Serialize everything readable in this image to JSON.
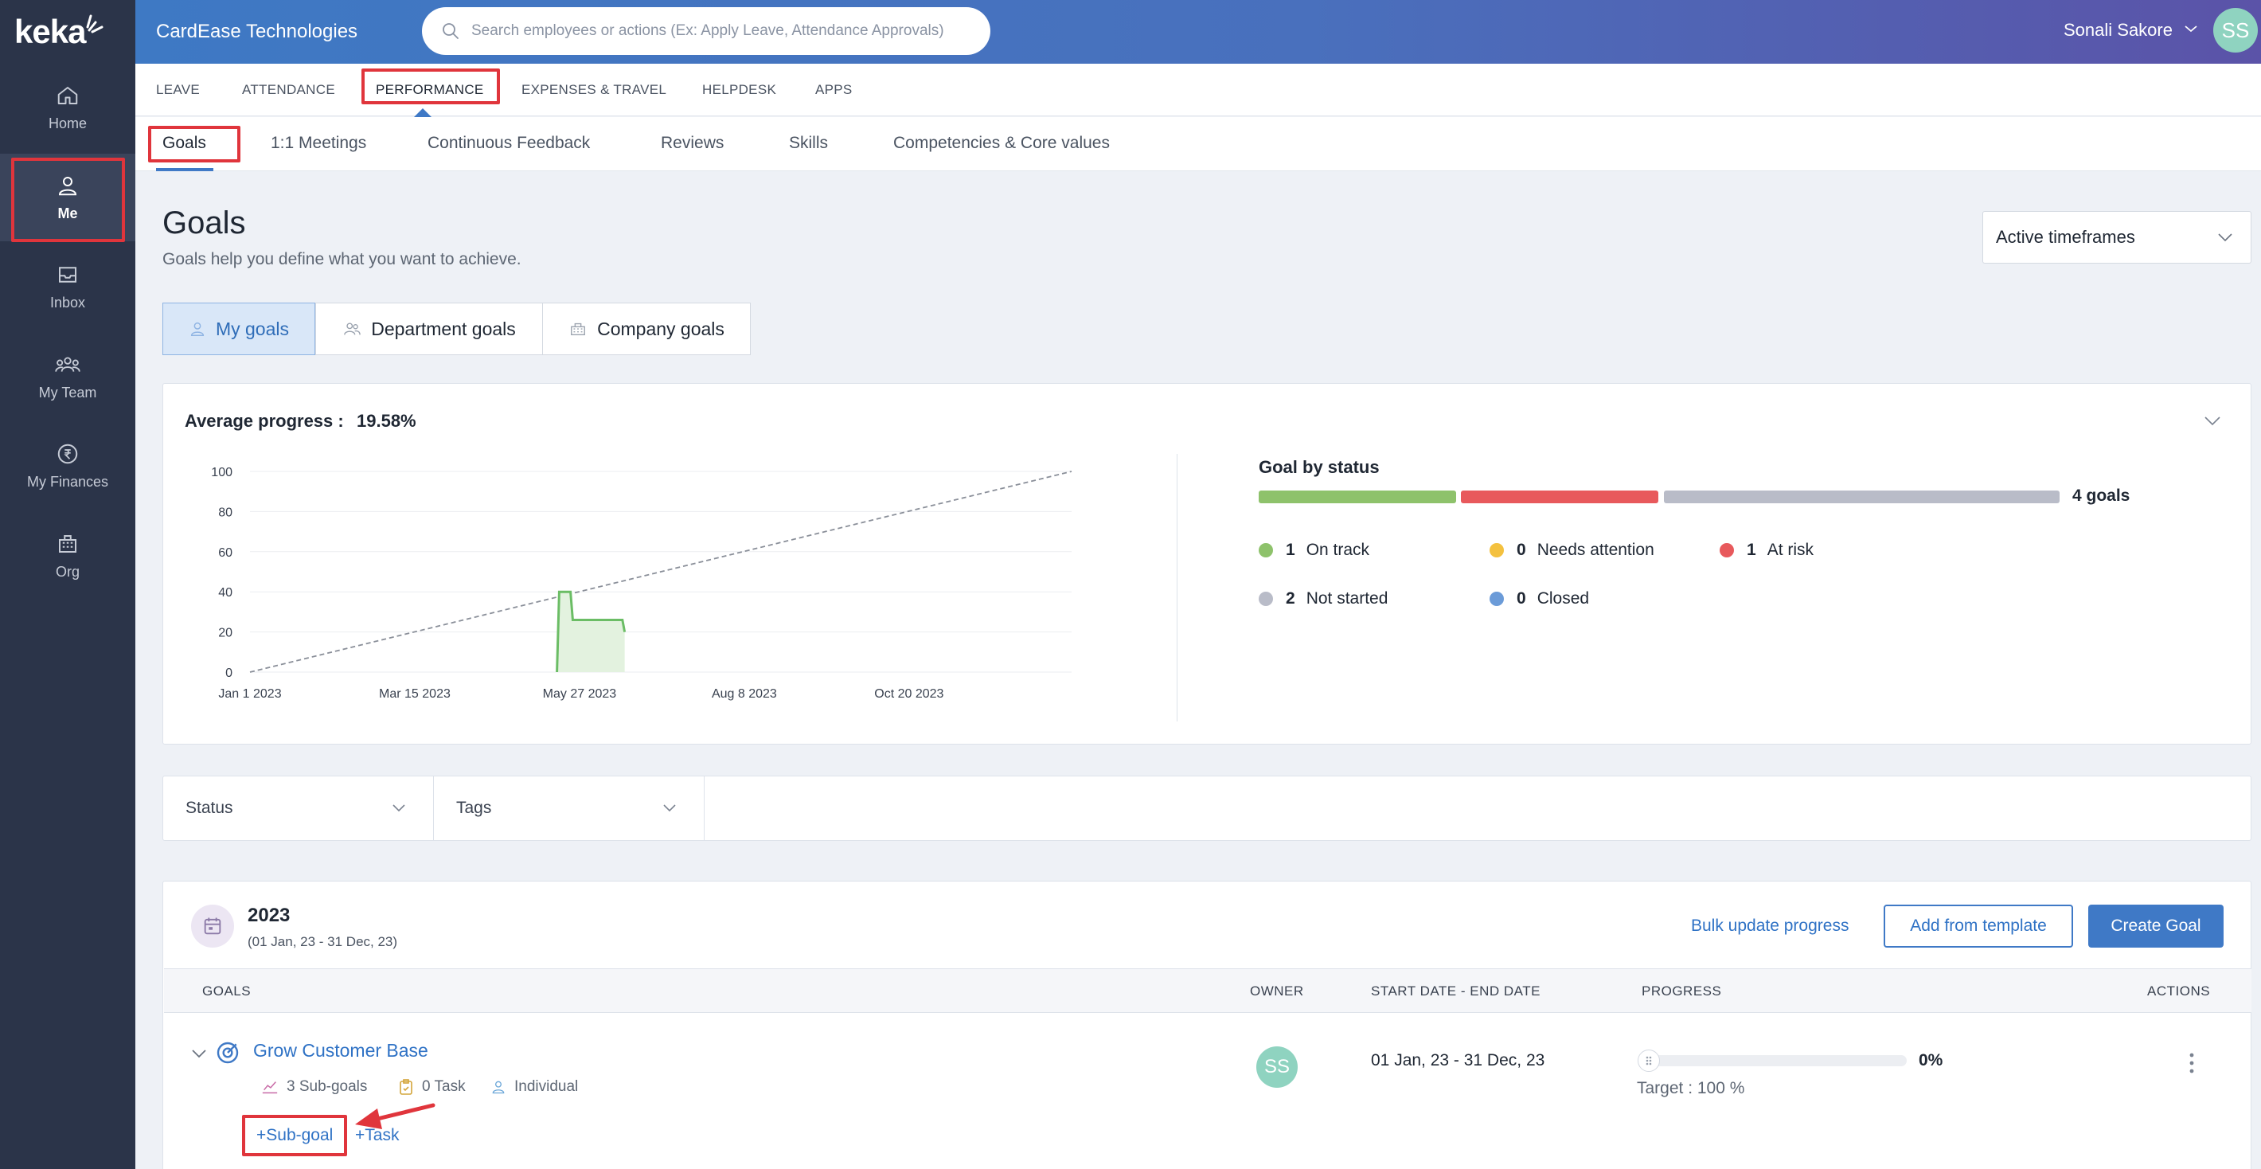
{
  "app": {
    "logo_text": "keka",
    "company_name": "CardEase Technologies",
    "user_name": "Sonali Sakore",
    "user_initials": "SS"
  },
  "search": {
    "placeholder": "Search employees or actions (Ex: Apply Leave, Attendance Approvals)"
  },
  "sidebar": {
    "items": [
      {
        "label": "Home",
        "icon": "home-icon"
      },
      {
        "label": "Me",
        "icon": "user-icon",
        "active": true
      },
      {
        "label": "Inbox",
        "icon": "inbox-icon"
      },
      {
        "label": "My Team",
        "icon": "team-icon"
      },
      {
        "label": "My Finances",
        "icon": "rupee-icon"
      },
      {
        "label": "Org",
        "icon": "org-icon"
      }
    ]
  },
  "module_tabs": [
    {
      "label": "LEAVE"
    },
    {
      "label": "ATTENDANCE"
    },
    {
      "label": "PERFORMANCE",
      "active": true
    },
    {
      "label": "EXPENSES & TRAVEL"
    },
    {
      "label": "HELPDESK"
    },
    {
      "label": "APPS"
    }
  ],
  "sub_tabs": [
    {
      "label": "Goals",
      "active": true
    },
    {
      "label": "1:1 Meetings"
    },
    {
      "label": "Continuous Feedback"
    },
    {
      "label": "Reviews"
    },
    {
      "label": "Skills"
    },
    {
      "label": "Competencies & Core values"
    }
  ],
  "page": {
    "title": "Goals",
    "subtitle": "Goals help you define what you want to achieve.",
    "timeframe_selected": "Active timeframes"
  },
  "goal_tabs": [
    {
      "label": "My goals",
      "active": true,
      "icon": "person-icon"
    },
    {
      "label": "Department goals",
      "icon": "group-icon"
    },
    {
      "label": "Company goals",
      "icon": "building-icon"
    }
  ],
  "progress_card": {
    "avg_label": "Average progress :",
    "avg_value": "19.58%"
  },
  "chart_data": {
    "type": "line",
    "title": "",
    "xlabel": "",
    "ylabel": "",
    "ylim": [
      0,
      100
    ],
    "y_ticks": [
      "100",
      "80",
      "60",
      "40",
      "20",
      "0"
    ],
    "x_ticks": [
      "Jan 1 2023",
      "Mar 15 2023",
      "May 27 2023",
      "Aug 8 2023",
      "Oct 20 2023"
    ],
    "x_range": [
      "2023-01-01",
      "2023-12-31"
    ],
    "grid": true,
    "series": [
      {
        "style": "dashed",
        "color": "#8a8f99",
        "x": [
          "2023-01-01",
          "2023-12-31"
        ],
        "y": [
          0,
          100
        ]
      },
      {
        "style": "solid-area",
        "color": "#6bbd65",
        "x": [
          "2023-05-17",
          "2023-05-18",
          "2023-05-23",
          "2023-05-24",
          "2023-06-15",
          "2023-06-16"
        ],
        "y": [
          0,
          40,
          40,
          26,
          26,
          20
        ]
      }
    ]
  },
  "goal_status": {
    "title": "Goal by status",
    "total_label": "4 goals",
    "segments": [
      {
        "label": "On track",
        "count": 1,
        "color": "#8ec26b"
      },
      {
        "label": "At risk",
        "count": 1,
        "color": "#e8595c"
      },
      {
        "label": "Not started",
        "count": 2,
        "color": "#b9bcc8"
      }
    ],
    "legend": [
      {
        "label": "On track",
        "count": "1",
        "color": "#8ec26b"
      },
      {
        "label": "Needs attention",
        "count": "0",
        "color": "#f4c13f"
      },
      {
        "label": "At risk",
        "count": "1",
        "color": "#e8595c"
      },
      {
        "label": "Not started",
        "count": "2",
        "color": "#b9bcc8"
      },
      {
        "label": "Closed",
        "count": "0",
        "color": "#6b9bd8"
      }
    ]
  },
  "filters": {
    "status_label": "Status",
    "tags_label": "Tags"
  },
  "timeframe_block": {
    "year": "2023",
    "range": "(01 Jan, 23 - 31 Dec, 23)",
    "bulk_update_label": "Bulk update progress",
    "add_template_label": "Add from template",
    "create_goal_label": "Create Goal"
  },
  "table": {
    "headers": [
      "GOALS",
      "OWNER",
      "START DATE - END DATE",
      "PROGRESS",
      "ACTIONS"
    ],
    "rows": [
      {
        "title": "Grow Customer Base",
        "subgoals": "3 Sub-goals",
        "tasks": "0 Task",
        "type": "Individual",
        "owner_initials": "SS",
        "dates": "01 Jan, 23 - 31 Dec, 23",
        "progress_text": "0%",
        "progress_value": 0,
        "target": "Target : 100 %",
        "add_subgoal_label": "+Sub-goal",
        "add_task_label": "+Task"
      }
    ]
  },
  "colors": {
    "accent": "#3f79c6",
    "sidebar_bg": "#2b3449",
    "highlight": "#e0353c"
  }
}
